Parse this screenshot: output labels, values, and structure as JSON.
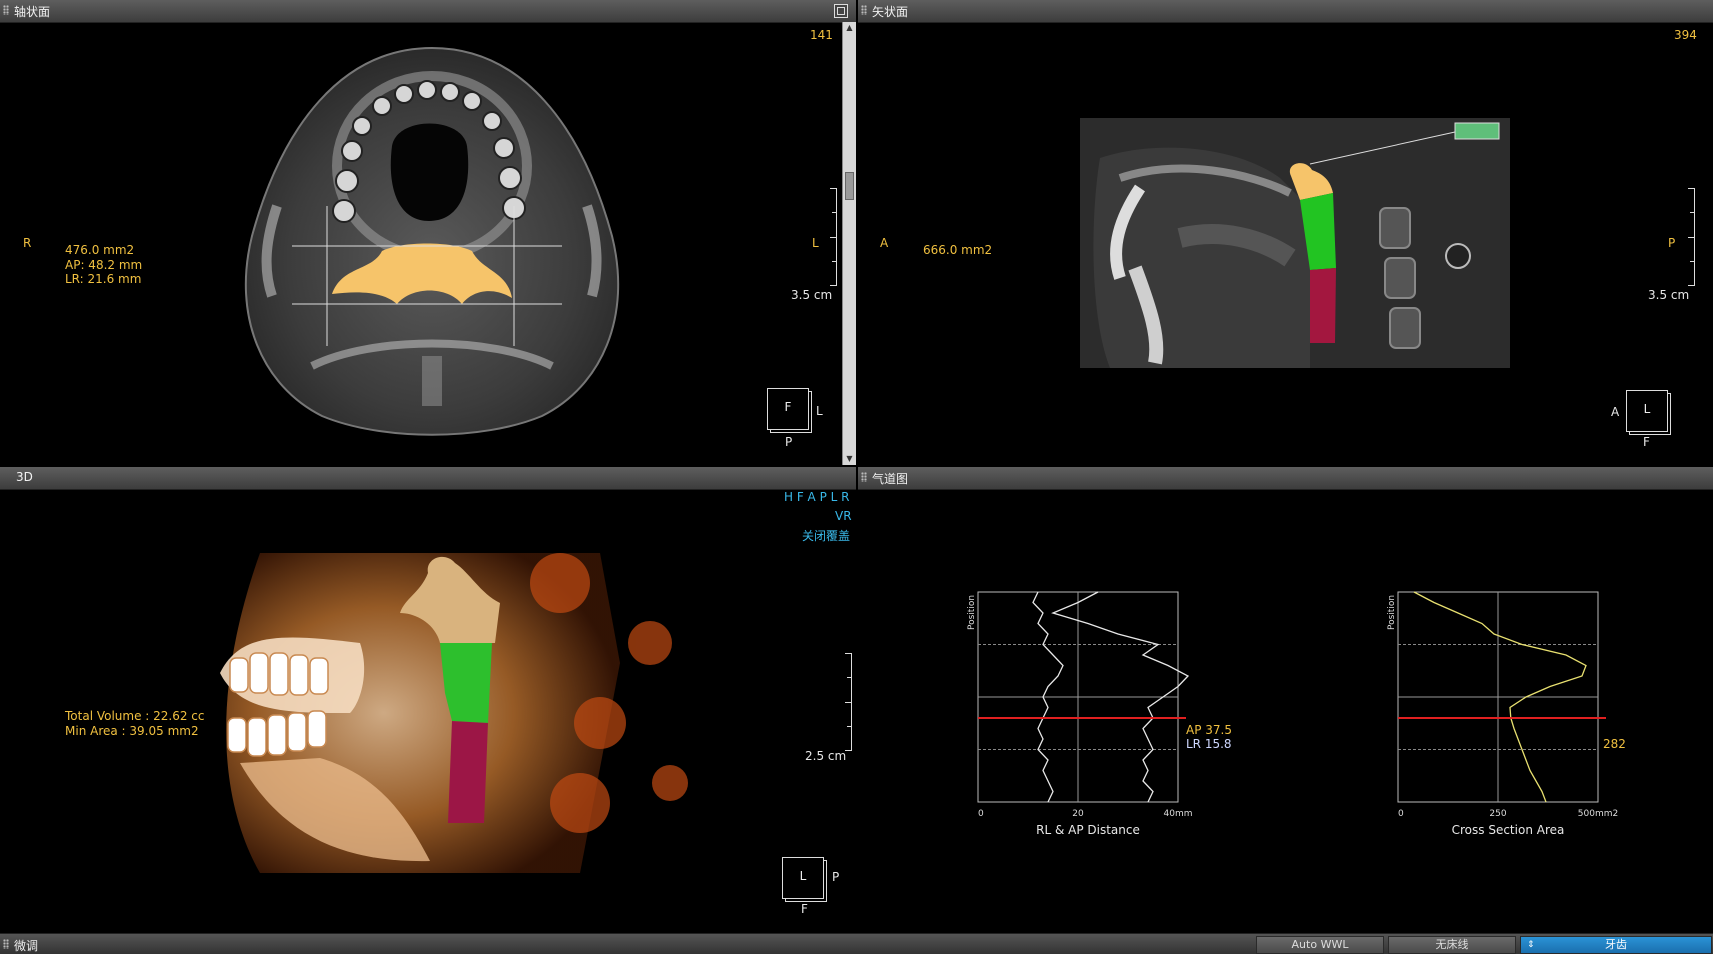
{
  "axial": {
    "title": "轴状面",
    "slice": "141",
    "side_left": "R",
    "area": "476.0 mm2",
    "ap": "AP: 48.2 mm",
    "lr": "LR: 21.6 mm",
    "scale_label": "3.5 cm",
    "scale_side": "L",
    "orient_center": "F",
    "orient_right": "L",
    "orient_bottom": "P"
  },
  "sagittal": {
    "title": "矢状面",
    "slice": "394",
    "side_left": "A",
    "area": "666.0 mm2",
    "scale_label": "3.5 cm",
    "scale_side": "P",
    "orient_center": "L",
    "orient_left": "A",
    "orient_bottom": "F"
  },
  "view3d": {
    "title": "3D",
    "directions": "H F A P L R",
    "mode": "VR",
    "overlay_toggle": "关闭覆盖",
    "total_volume": "Total Volume : 22.62 cc",
    "min_area": "Min Area : 39.05 mm2",
    "scale_label": "2.5 cm",
    "orient_center": "L",
    "orient_right": "P",
    "orient_bottom": "F"
  },
  "airway": {
    "title": "气道图",
    "readout_ap": "AP 37.5",
    "readout_lr": "LR 15.8",
    "readout_area": "282"
  },
  "bottom_bar": {
    "title": "微调",
    "btn_auto_wwl": "Auto WWL",
    "btn_no_bed": "无床线",
    "btn_teeth": "牙齿"
  },
  "colors": {
    "segment_top": "#f6c46a",
    "segment_mid": "#22c422",
    "segment_low": "#a3173f",
    "accent_blue": "#2b93d6",
    "label_yellow": "#f0c040"
  },
  "chart_data": [
    {
      "type": "line",
      "title": "",
      "xlabel": "RL & AP Distance",
      "ylabel": "Position",
      "xlim": [
        0,
        40
      ],
      "x_ticks": [
        "0",
        "20",
        "40mm"
      ],
      "series": [
        {
          "values_position": [
            0,
            0.05,
            0.1,
            0.15,
            0.2,
            0.25,
            0.3,
            0.35,
            0.4,
            0.45,
            0.5,
            0.55,
            0.6,
            0.65,
            0.7,
            0.75,
            0.8,
            0.85,
            0.9,
            0.95,
            1.0
          ],
          "values": [
            12,
            11,
            13,
            12,
            14,
            13,
            15,
            17,
            16,
            14,
            13,
            14,
            13,
            12,
            13,
            12,
            14,
            13,
            14,
            15,
            14
          ]
        },
        {
          "values_position": [
            0,
            0.05,
            0.1,
            0.15,
            0.2,
            0.25,
            0.3,
            0.35,
            0.4,
            0.45,
            0.5,
            0.55,
            0.6,
            0.65,
            0.7,
            0.75,
            0.8,
            0.85,
            0.9,
            0.95,
            1.0
          ],
          "values": [
            24,
            20,
            15,
            22,
            28,
            36,
            33,
            38,
            42,
            40,
            37,
            34,
            35,
            33,
            34,
            35,
            33,
            34,
            33,
            35,
            34
          ]
        }
      ],
      "cursor_position": 0.6
    },
    {
      "type": "line",
      "title": "",
      "xlabel": "Cross Section Area",
      "ylabel": "Position",
      "xlim": [
        0,
        500
      ],
      "x_ticks": [
        "0",
        "250",
        "500mm2"
      ],
      "series": [
        {
          "values_position": [
            0,
            0.05,
            0.1,
            0.15,
            0.2,
            0.25,
            0.3,
            0.35,
            0.4,
            0.45,
            0.5,
            0.55,
            0.6,
            0.65,
            0.7,
            0.75,
            0.8,
            0.85,
            0.9,
            0.95,
            1.0
          ],
          "values": [
            40,
            90,
            150,
            210,
            240,
            310,
            420,
            470,
            460,
            380,
            320,
            280,
            282,
            290,
            300,
            310,
            320,
            330,
            345,
            360,
            370
          ]
        }
      ],
      "cursor_position": 0.6
    }
  ]
}
